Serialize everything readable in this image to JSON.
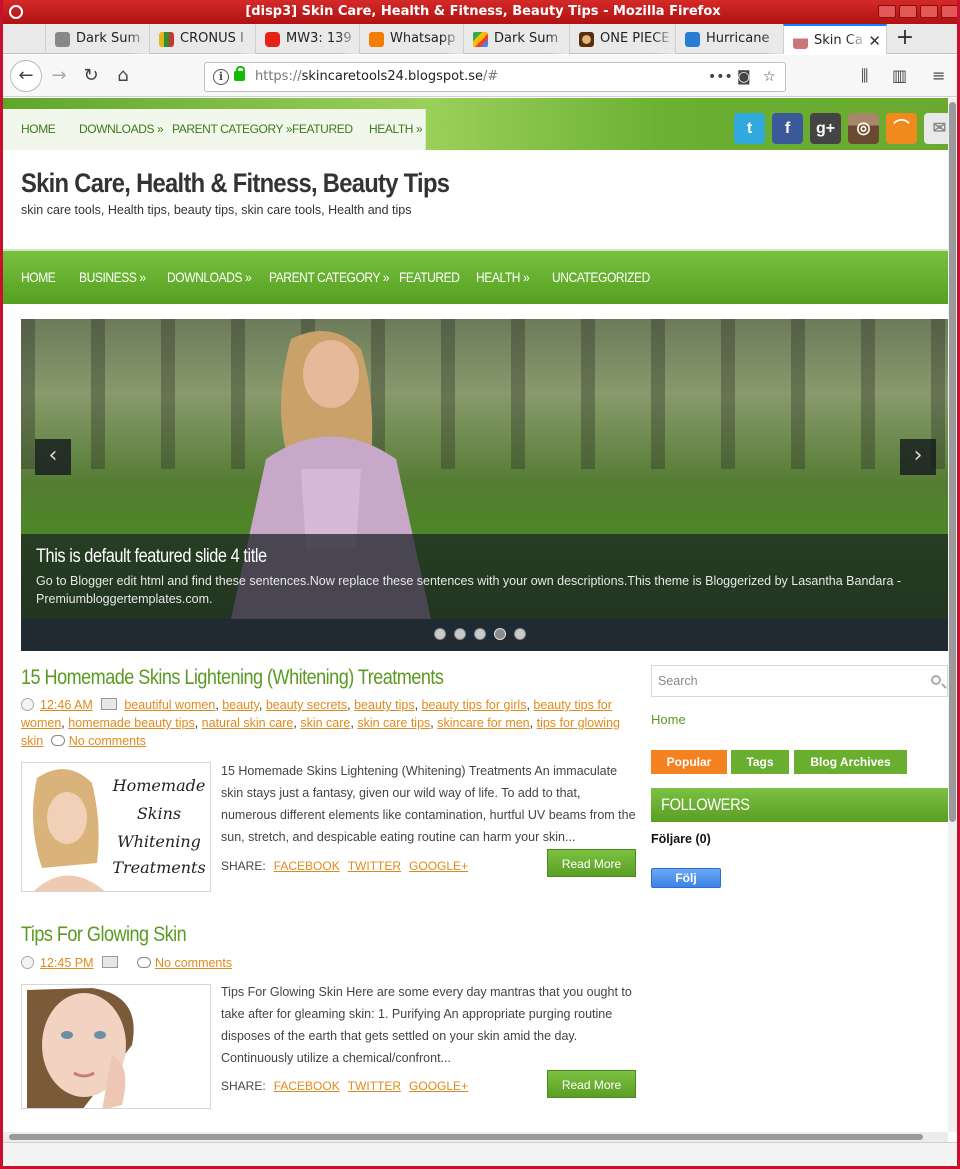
{
  "window": {
    "title": "[disp3] Skin Care, Health & Fitness, Beauty Tips - Mozilla Firefox"
  },
  "tabs": [
    {
      "label": "Dark Sum",
      "icon": "page-icon",
      "color": "#888888"
    },
    {
      "label": "CRONUS I",
      "icon": "cronus-icon",
      "color": "#e8b21c"
    },
    {
      "label": "MW3: 139",
      "icon": "youtube-icon",
      "color": "#e62117"
    },
    {
      "label": "Whatsapp",
      "icon": "blogger-icon",
      "color": "#f57d00"
    },
    {
      "label": "Dark Sum",
      "icon": "google-play-icon",
      "color": "#34a853"
    },
    {
      "label": "ONE PIECE",
      "icon": "manga-icon",
      "color": "#b05020"
    },
    {
      "label": "Hurricane",
      "icon": "hurricane-icon",
      "color": "#2a7bd4"
    },
    {
      "label": "Skin Ca",
      "icon": "skin-care-icon",
      "color": "#c77"
    }
  ],
  "url": {
    "prefix": "https://",
    "host": "skincaretools24.blogspot.se",
    "path": "/#"
  },
  "top_menu": [
    "HOME",
    "DOWNLOADS »",
    "PARENT CATEGORY »",
    "FEATURED",
    "HEALTH »"
  ],
  "social": [
    {
      "name": "twitter",
      "glyph": "t",
      "color": "#33aadd"
    },
    {
      "name": "facebook",
      "glyph": "f",
      "color": "#3b5998"
    },
    {
      "name": "google-plus",
      "glyph": "g+",
      "color": "#444444"
    },
    {
      "name": "instagram",
      "glyph": "◎",
      "color": "#7a5a3e"
    },
    {
      "name": "rss",
      "glyph": "⌒",
      "color": "#f08a1c"
    },
    {
      "name": "email",
      "glyph": "✉",
      "color": "#d8d8d8"
    }
  ],
  "site": {
    "title": "Skin Care, Health & Fitness, Beauty Tips",
    "tagline": "skin care tools, Health tips, beauty tips, skin care tools, Health and tips"
  },
  "main_nav": [
    "HOME",
    "BUSINESS »",
    "DOWNLOADS »",
    "PARENT CATEGORY »",
    "FEATURED",
    "HEALTH »",
    "UNCATEGORIZED"
  ],
  "slider": {
    "title": "This is default featured slide 4 title",
    "description": "Go to Blogger edit html and find these sentences.Now replace these sentences with your own descriptions.This theme is Bloggerized by Lasantha Bandara - Premiumbloggertemplates.com.",
    "prev": "‹",
    "next": "›",
    "slide_count": 5,
    "active_slide": 4
  },
  "posts": [
    {
      "title": "15 Homemade Skins Lightening (Whitening) Treatments",
      "time": "12:46 AM",
      "labels": [
        "beautiful women",
        "beauty",
        "beauty secrets",
        "beauty tips",
        "beauty tips for girls",
        "beauty tips for women",
        "homemade beauty tips",
        "natural skin care",
        "skin care",
        "skin care tips",
        "skincare for men",
        "tips for glowing skin"
      ],
      "comments": "No comments",
      "thumb_text": "Homemade Skins Whitening Treatments",
      "excerpt": "15 Homemade Skins Lightening (Whitening) Treatments An immaculate skin stays just a fantasy, given our wild way of life. To add to that, numerous different elements like contamination, hurtful UV beams from the sun, stretch, and despicable eating routine can harm your skin...",
      "share_label": "SHARE:",
      "share": [
        "FACEBOOK",
        "TWITTER",
        "GOOGLE+"
      ],
      "read_more": "Read More"
    },
    {
      "title": "Tips For Glowing Skin",
      "time": "12:45 PM",
      "labels": [],
      "comments": "No comments",
      "excerpt": "Tips For Glowing Skin Here are some every day mantras that you ought to take after for gleaming skin: 1. Purifying An appropriate purging routine disposes of the earth that gets settled on your skin amid the day. Continuously utilize a chemical/confront...",
      "share_label": "SHARE:",
      "share": [
        "FACEBOOK",
        "TWITTER",
        "GOOGLE+"
      ],
      "read_more": "Read More"
    }
  ],
  "sidebar": {
    "search_placeholder": "Search",
    "home_link": "Home",
    "tabs": [
      {
        "label": "Popular",
        "color": "#f58220"
      },
      {
        "label": "Tags",
        "color": "#6aae30"
      },
      {
        "label": "Blog Archives",
        "color": "#6aae30"
      }
    ],
    "followers_title": "FOLLOWERS",
    "followers_count": "Följare (0)",
    "follow_button": "Följ"
  },
  "colors": {
    "accent_green": "#5a9a21",
    "link_orange": "#e08a1c",
    "window_red": "#c8102e"
  }
}
